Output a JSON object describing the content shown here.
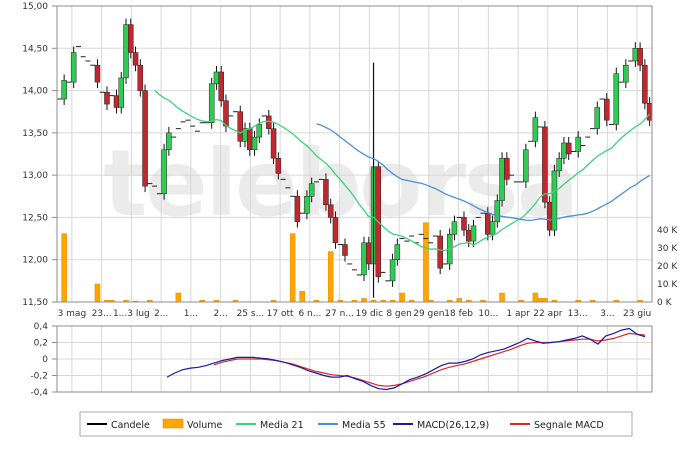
{
  "watermark": "teleborsa",
  "legend": [
    {
      "label": "Candele",
      "color": "#000000",
      "kind": "line"
    },
    {
      "label": "Volume",
      "color": "#ffa500",
      "kind": "box"
    },
    {
      "label": "Media 21",
      "color": "#3cd37c",
      "kind": "line"
    },
    {
      "label": "Media 55",
      "color": "#4a90d9",
      "kind": "line"
    },
    {
      "label": "MACD(26,12,9)",
      "color": "#1a1aa8",
      "kind": "line"
    },
    {
      "label": "Segnale MACD",
      "color": "#d62a2a",
      "kind": "line"
    }
  ],
  "colors": {
    "up": "#2ecc52",
    "down": "#c0282f",
    "volume": "#ffa500",
    "media21": "#3cd37c",
    "media55": "#4a90d9",
    "macd": "#1a1aa8",
    "signal": "#d62a2a",
    "grid": "#d8d8d8",
    "frame": "#8c8c8c"
  },
  "chart_data": [
    {
      "type": "candlestick",
      "x_tick_labels": [
        "3 mag",
        "23...",
        "1...3 lug",
        "2...",
        "1...",
        "2...",
        "25 s...",
        "17 ott",
        "6 n...",
        "27 n...",
        "19 dic",
        "8 gen",
        "29 gen",
        "18 feb",
        "10...",
        "1 apr",
        "22 apr",
        "13...",
        "3...",
        "23 giu"
      ],
      "y_tick_labels": [
        "15,00",
        "14,50",
        "14,00",
        "13,50",
        "13,00",
        "12,50",
        "12,00",
        "11,50"
      ],
      "ylim": [
        11.5,
        15.0
      ],
      "volume_tick_labels": [
        "40 K",
        "30 K",
        "20 K",
        "10 K",
        "0 K"
      ],
      "volume_lim": [
        0,
        50
      ],
      "grid": true,
      "close": [
        13.9,
        14.12,
        14.1,
        14.45,
        14.52,
        14.4,
        14.35,
        14.3,
        14.1,
        13.98,
        13.84,
        13.94,
        13.8,
        14.15,
        14.78,
        14.45,
        14.3,
        14.0,
        12.87,
        12.9,
        12.87,
        12.78,
        13.3,
        13.5,
        13.45,
        13.55,
        13.63,
        13.65,
        13.58,
        13.52,
        13.62,
        13.62,
        14.08,
        14.22,
        13.88,
        13.58,
        13.7,
        13.75,
        13.4,
        13.55,
        13.3,
        13.45,
        13.6,
        13.7,
        13.55,
        13.2,
        13.02,
        12.95,
        12.85,
        12.75,
        12.45,
        12.55,
        12.75,
        12.9,
        12.92,
        12.95,
        12.65,
        12.5,
        12.2,
        12.18,
        12.05,
        11.95,
        11.88,
        11.82,
        12.2,
        11.95,
        13.1,
        11.8,
        11.85,
        11.75,
        12.0,
        12.18,
        12.25,
        12.22,
        12.28,
        12.2,
        12.3,
        12.25,
        12.2,
        12.28,
        11.9,
        11.95,
        12.3,
        12.45,
        12.5,
        12.35,
        12.22,
        12.4,
        12.5,
        12.55,
        12.3,
        12.45,
        12.7,
        13.2,
        12.95,
        13.0,
        12.92,
        12.92,
        13.3,
        13.4,
        13.68,
        13.57,
        12.68,
        12.35,
        13.05,
        13.2,
        13.38,
        13.25,
        13.28,
        13.45,
        13.35,
        13.45,
        13.55,
        13.8,
        13.9,
        13.65,
        13.6,
        14.2,
        14.1,
        14.3,
        14.35,
        14.5,
        14.3,
        13.85,
        13.65
      ]
    },
    {
      "type": "line",
      "y_tick_labels": [
        "0,4",
        "0,2",
        "0",
        "-0,2",
        "-0,4"
      ],
      "ylim": [
        -0.4,
        0.4
      ],
      "grid": true,
      "series": [
        {
          "name": "MACD(26,12,9)",
          "values": [
            -0.22,
            -0.17,
            -0.13,
            -0.11,
            -0.1,
            -0.08,
            -0.05,
            -0.02,
            0.0,
            0.02,
            0.02,
            0.02,
            0.01,
            0.0,
            -0.02,
            -0.04,
            -0.07,
            -0.1,
            -0.14,
            -0.17,
            -0.2,
            -0.22,
            -0.22,
            -0.2,
            -0.24,
            -0.27,
            -0.32,
            -0.36,
            -0.37,
            -0.35,
            -0.3,
            -0.25,
            -0.22,
            -0.18,
            -0.13,
            -0.08,
            -0.05,
            -0.05,
            -0.03,
            0.0,
            0.05,
            0.08,
            0.1,
            0.12,
            0.16,
            0.2,
            0.25,
            0.22,
            0.19,
            0.2,
            0.21,
            0.23,
            0.25,
            0.28,
            0.24,
            0.18,
            0.28,
            0.31,
            0.35,
            0.37,
            0.3,
            0.27
          ]
        },
        {
          "name": "Segnale MACD",
          "values": [
            null,
            null,
            null,
            null,
            null,
            null,
            -0.07,
            -0.04,
            -0.02,
            0.0,
            0.0,
            0.0,
            0.0,
            -0.01,
            -0.02,
            -0.04,
            -0.06,
            -0.09,
            -0.12,
            -0.15,
            -0.17,
            -0.19,
            -0.2,
            -0.21,
            -0.23,
            -0.26,
            -0.29,
            -0.32,
            -0.33,
            -0.32,
            -0.3,
            -0.27,
            -0.24,
            -0.21,
            -0.17,
            -0.13,
            -0.1,
            -0.08,
            -0.06,
            -0.03,
            0.0,
            0.03,
            0.06,
            0.09,
            0.12,
            0.16,
            0.19,
            0.2,
            0.2,
            0.2,
            0.21,
            0.22,
            0.23,
            0.24,
            0.24,
            0.22,
            0.23,
            0.25,
            0.28,
            0.31,
            0.3,
            0.29
          ]
        }
      ]
    }
  ]
}
